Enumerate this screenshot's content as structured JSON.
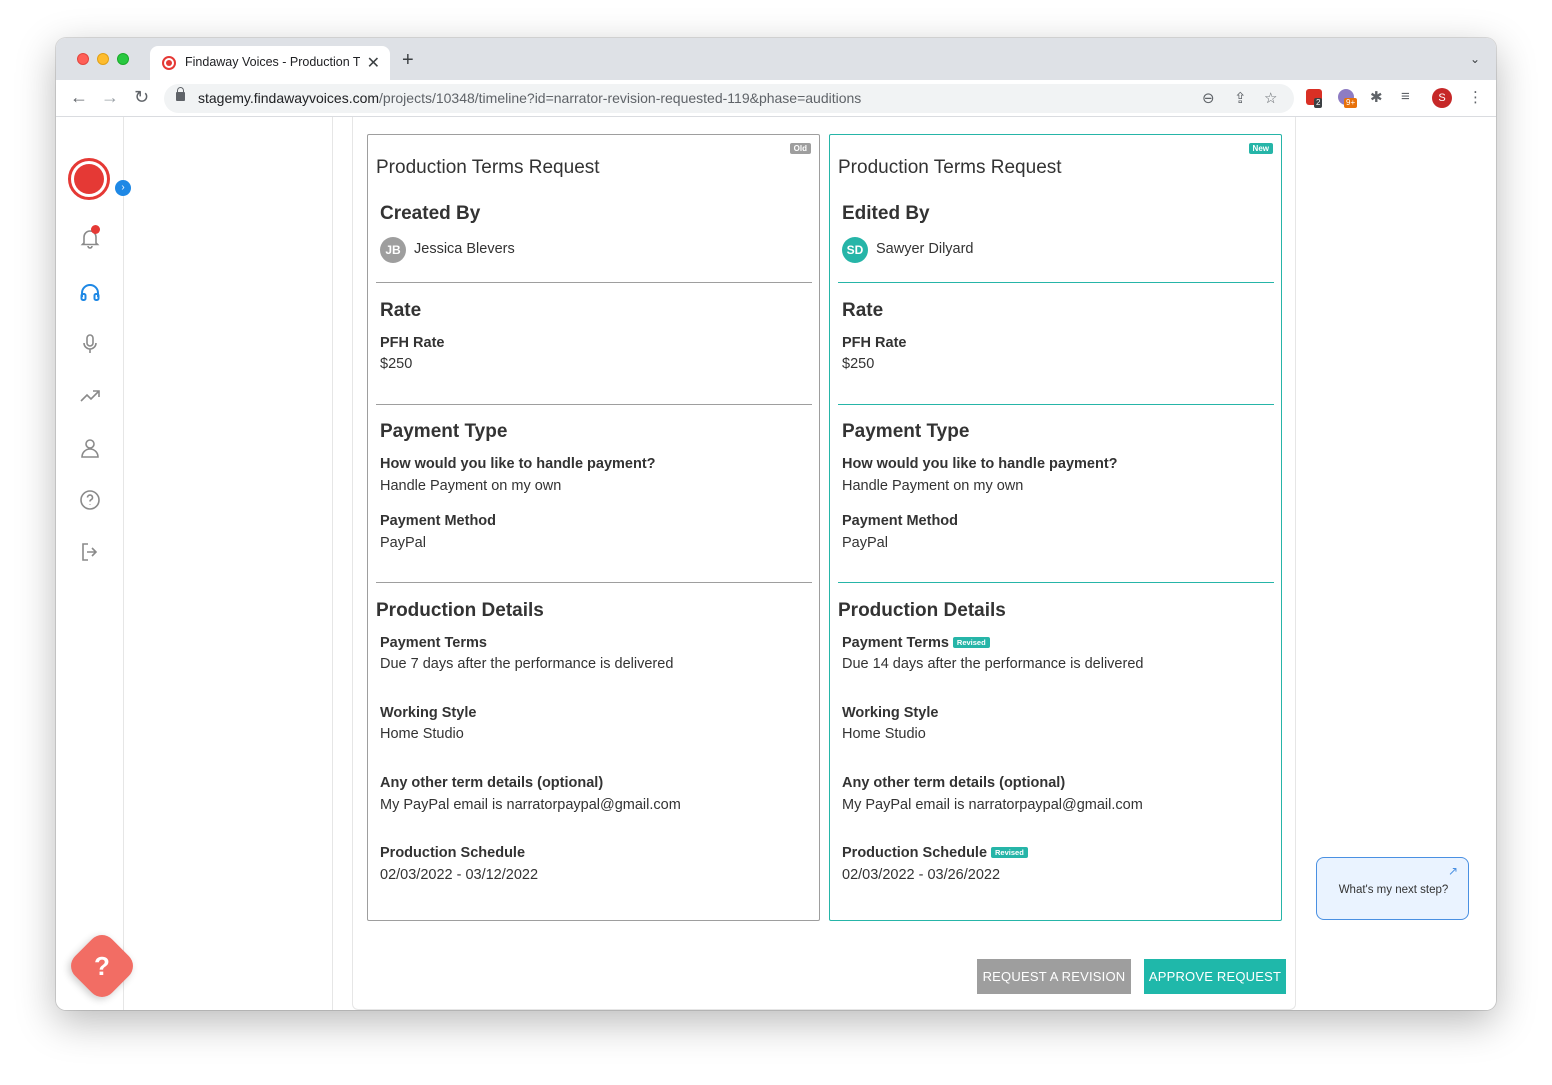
{
  "browser": {
    "tab_title": "Findaway Voices - Production T",
    "url_host": "stagemy.findawayvoices.com",
    "url_path": "/projects/10348/timeline?id=narrator-revision-requested-119&phase=auditions",
    "ext_badge_1": "2",
    "ext_badge_2": "9+",
    "profile_initial": "S"
  },
  "sidebar": {
    "icons": [
      "logo-icon",
      "bell-icon",
      "headphones-icon",
      "microphone-icon",
      "trending-icon",
      "user-icon",
      "help-circle-icon",
      "logout-icon"
    ],
    "help_label": "?"
  },
  "old_card": {
    "badge": "Old",
    "title": "Production Terms Request",
    "author_heading": "Created By",
    "author_initials": "JB",
    "author_name": "Jessica Blevers",
    "rate_heading": "Rate",
    "pfh_label": "PFH Rate",
    "pfh_value": "$250",
    "payment_heading": "Payment Type",
    "handle_label": "How would you like to handle payment?",
    "handle_value": "Handle Payment on my own",
    "method_label": "Payment Method",
    "method_value": "PayPal",
    "details_heading": "Production Details",
    "terms_label": "Payment Terms",
    "terms_value": "Due 7 days after the performance is delivered",
    "style_label": "Working Style",
    "style_value": "Home Studio",
    "other_label": "Any other term details (optional)",
    "other_value": "My PayPal email is narratorpaypal@gmail.com",
    "schedule_label": "Production Schedule",
    "schedule_value": "02/03/2022 - 03/12/2022"
  },
  "new_card": {
    "badge": "New",
    "title": "Production Terms Request",
    "author_heading": "Edited By",
    "author_initials": "SD",
    "author_name": "Sawyer Dilyard",
    "rate_heading": "Rate",
    "pfh_label": "PFH Rate",
    "pfh_value": "$250",
    "payment_heading": "Payment Type",
    "handle_label": "How would you like to handle payment?",
    "handle_value": "Handle Payment on my own",
    "method_label": "Payment Method",
    "method_value": "PayPal",
    "details_heading": "Production Details",
    "terms_label": "Payment Terms",
    "terms_revised": "Revised",
    "terms_value": "Due 14 days after the performance is delivered",
    "style_label": "Working Style",
    "style_value": "Home Studio",
    "other_label": "Any other term details (optional)",
    "other_value": "My PayPal email is narratorpaypal@gmail.com",
    "schedule_label": "Production Schedule",
    "schedule_revised": "Revised",
    "schedule_value": "02/03/2022 - 03/26/2022"
  },
  "actions": {
    "revise_label": "REQUEST A REVISION",
    "approve_label": "APPROVE REQUEST"
  },
  "next_step": {
    "label": "What's my next step?"
  },
  "colors": {
    "accent": "#1fb8aa",
    "brand_red": "#e53935",
    "muted_button": "#9e9e9e"
  }
}
